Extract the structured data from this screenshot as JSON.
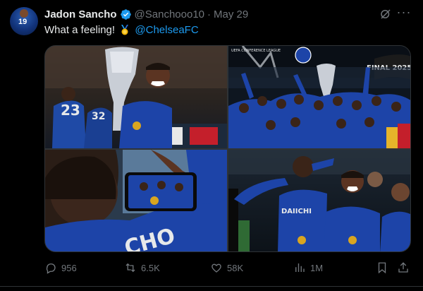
{
  "author": {
    "name": "Jadon Sancho",
    "handle": "@Sanchooo10",
    "separator": "·",
    "date": "May 29",
    "avatar_number": "19"
  },
  "tweet": {
    "text_before": "What a feeling!",
    "emoji": "medal-emoji",
    "mention": "@ChelseaFC"
  },
  "media": {
    "photos": [
      {
        "jersey_left": "23",
        "jersey_right": "32"
      },
      {
        "banner": "UEFA CONFERENCE LEAGUE",
        "title": "FINAL 2025"
      },
      {
        "back_text": "CHO"
      },
      {
        "sponsor": "DAIICHI"
      }
    ]
  },
  "actions": {
    "reply_count": "956",
    "retweet_count": "6.5K",
    "like_count": "58K",
    "view_count": "1M"
  },
  "colors": {
    "accent": "#1d9bf0",
    "muted": "#71767b",
    "text": "#e7e9ea",
    "background": "#000000",
    "chelsea_blue": "#1d44a8"
  }
}
